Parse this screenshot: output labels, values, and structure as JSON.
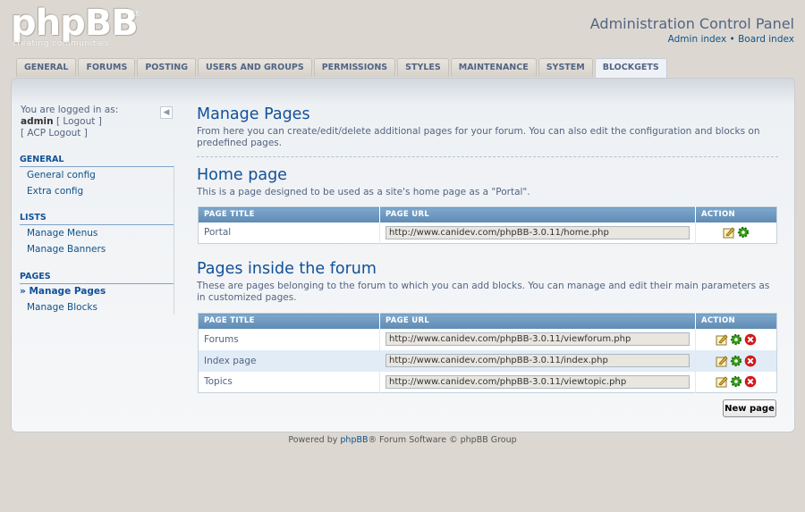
{
  "logo": {
    "word": "phpBB",
    "reg": "®",
    "tagline": "creating  communities"
  },
  "header": {
    "title": "Administration Control Panel",
    "link_admin": "Admin index",
    "sep": "•",
    "link_board": "Board index"
  },
  "tabs": [
    "GENERAL",
    "FORUMS",
    "POSTING",
    "USERS AND GROUPS",
    "PERMISSIONS",
    "STYLES",
    "MAINTENANCE",
    "SYSTEM",
    "BLOCKGETS"
  ],
  "sidebar": {
    "logged_in_label": "You are logged in as:",
    "user": "admin",
    "logout": "[ Logout ]",
    "acp_logout": "[ ACP Logout ]",
    "collapse": "◀",
    "sections": [
      {
        "title": "GENERAL",
        "items": [
          "General config",
          "Extra config"
        ]
      },
      {
        "title": "LISTS",
        "items": [
          "Manage Menus",
          "Manage Banners"
        ]
      },
      {
        "title": "PAGES",
        "items": [
          "Manage Pages",
          "Manage Blocks"
        ]
      }
    ],
    "active_item": "Manage Pages"
  },
  "manage": {
    "title": "Manage Pages",
    "desc": "From here you can create/edit/delete additional pages for your forum. You can also edit the configuration and blocks on predefined pages."
  },
  "home": {
    "title": "Home page",
    "desc": "This is a page designed to be used as a site's home page as a \"Portal\".",
    "headers": [
      "PAGE TITLE",
      "PAGE URL",
      "ACTION"
    ],
    "rows": [
      {
        "title": "Portal",
        "url": "http://www.canidev.com/phpBB-3.0.11/home.php"
      }
    ]
  },
  "forum": {
    "title": "Pages inside the forum",
    "desc": "These are pages belonging to the forum to which you can add blocks. You can manage and edit their main parameters as in customized pages.",
    "headers": [
      "PAGE TITLE",
      "PAGE URL",
      "ACTION"
    ],
    "rows": [
      {
        "title": "Forums",
        "url": "http://www.canidev.com/phpBB-3.0.11/viewforum.php"
      },
      {
        "title": "Index page",
        "url": "http://www.canidev.com/phpBB-3.0.11/index.php"
      },
      {
        "title": "Topics",
        "url": "http://www.canidev.com/phpBB-3.0.11/viewtopic.php"
      }
    ]
  },
  "new_page_button": "New page",
  "footer": {
    "pre": "Powered by ",
    "link": "phpBB",
    "post": "® Forum Software © phpBB Group"
  },
  "icons": {
    "edit": "edit-icon",
    "config": "gear-icon",
    "delete": "delete-icon"
  },
  "colors": {
    "accent": "#115098",
    "table_header": "#6d97bf",
    "delete": "#d01a1a",
    "gear": "#3aa01a"
  }
}
